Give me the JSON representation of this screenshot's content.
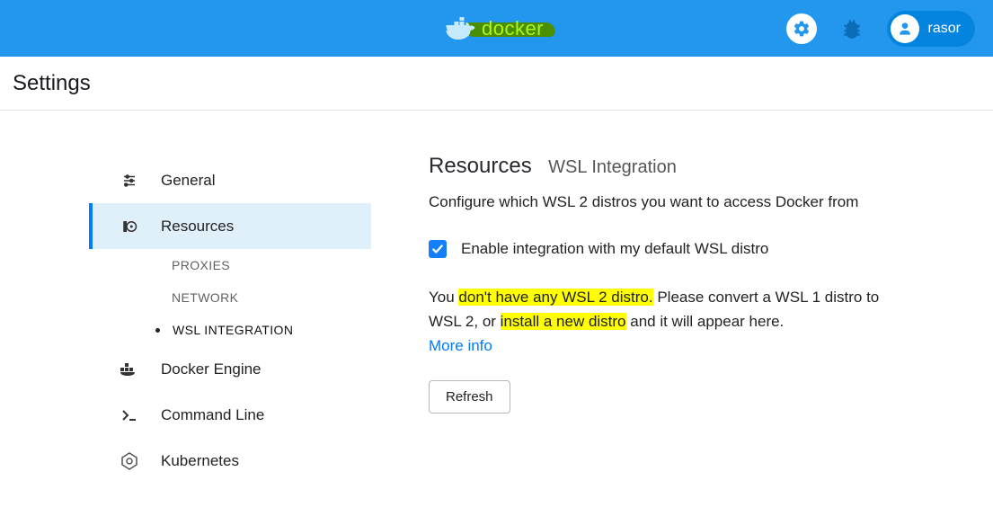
{
  "header": {
    "logo_text": "docker",
    "username": "rasor"
  },
  "page_title": "Settings",
  "sidebar": {
    "items": [
      {
        "label": "General"
      },
      {
        "label": "Resources",
        "subs": [
          {
            "label": "PROXIES"
          },
          {
            "label": "NETWORK"
          },
          {
            "label": "WSL INTEGRATION"
          }
        ]
      },
      {
        "label": "Docker Engine"
      },
      {
        "label": "Command Line"
      },
      {
        "label": "Kubernetes"
      }
    ]
  },
  "content": {
    "heading": "Resources",
    "subtitle": "WSL Integration",
    "description": "Configure which WSL 2 distros you want to access Docker from",
    "checkbox_label": "Enable integration with my default WSL distro",
    "checkbox_checked": true,
    "paragraph": {
      "p1": "You ",
      "hl1": "don't have any WSL 2 distro.",
      "p2": " Please convert a WSL 1 distro to WSL 2, or ",
      "hl2": "install a new distro",
      "p3": " and it will appear here."
    },
    "more_info": "More info",
    "refresh_label": "Refresh"
  }
}
